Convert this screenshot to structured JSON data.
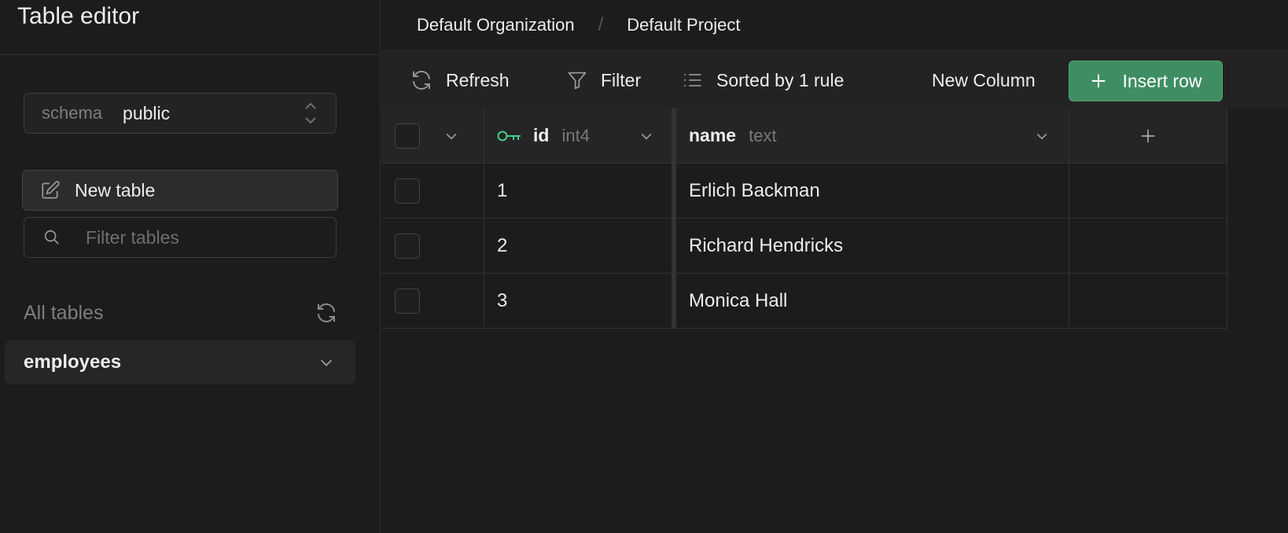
{
  "sidebar": {
    "title": "Table editor",
    "schema": {
      "label": "schema",
      "value": "public"
    },
    "new_table_label": "New table",
    "filter_placeholder": "Filter tables",
    "all_tables_label": "All tables",
    "tables": [
      {
        "label": "employees"
      }
    ]
  },
  "breadcrumb": {
    "organization": "Default Organization",
    "separator": "/",
    "project": "Default Project"
  },
  "toolbar": {
    "refresh_label": "Refresh",
    "filter_label": "Filter",
    "sort_label": "Sorted by 1 rule",
    "new_column_label": "New Column",
    "insert_row_label": "Insert row"
  },
  "grid": {
    "columns": [
      {
        "name": "id",
        "type": "int4",
        "primary_key": true
      },
      {
        "name": "name",
        "type": "text",
        "primary_key": false
      }
    ],
    "rows": [
      {
        "id": "1",
        "name": "Erlich Backman"
      },
      {
        "id": "2",
        "name": "Richard Hendricks"
      },
      {
        "id": "3",
        "name": "Monica Hall"
      }
    ]
  },
  "colors": {
    "background": "#1c1c1c",
    "accent_green": "#3f8e63",
    "key_icon": "#3ecf8e"
  }
}
